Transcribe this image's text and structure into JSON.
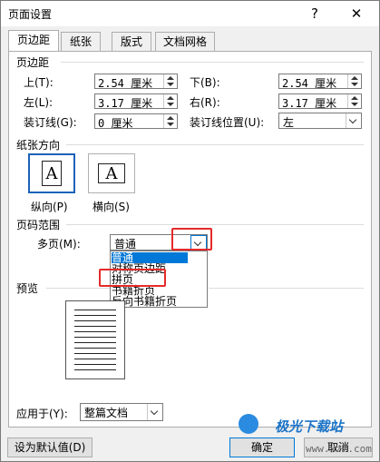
{
  "window": {
    "title": "页面设置",
    "help": "?",
    "close": "✕"
  },
  "tabs": [
    "页边距",
    "纸张",
    "版式",
    "文档网格"
  ],
  "margins": {
    "section": "页边距",
    "top_label": "上(T):",
    "top": "2.54 厘米",
    "bottom_label": "下(B):",
    "bottom": "2.54 厘米",
    "left_label": "左(L):",
    "left": "3.17 厘米",
    "right_label": "右(R):",
    "right": "3.17 厘米",
    "gutter_label": "装订线(G):",
    "gutter": "0 厘米",
    "gutter_pos_label": "装订线位置(U):",
    "gutter_pos": "左"
  },
  "orientation": {
    "section": "纸张方向",
    "portrait": "纵向(P)",
    "landscape": "横向(S)",
    "glyph": "A",
    "selected": "portrait"
  },
  "pages": {
    "section": "页码范围",
    "multiple_label": "多页(M):",
    "multiple_value": "普通",
    "options": [
      "普通",
      "对称页边距",
      "拼页",
      "书籍折页",
      "反向书籍折页"
    ],
    "highlighted": "普通"
  },
  "preview": {
    "section": "预览"
  },
  "apply": {
    "label": "应用于(Y):",
    "value": "整篇文档"
  },
  "footer": {
    "default": "设为默认值(D)",
    "ok": "确定",
    "cancel": "取消"
  },
  "watermark": {
    "name": "极光下载站",
    "url": "www.xz7.com"
  },
  "colors": {
    "accent": "#0078d7",
    "highlight_box": "#e52a2a"
  }
}
